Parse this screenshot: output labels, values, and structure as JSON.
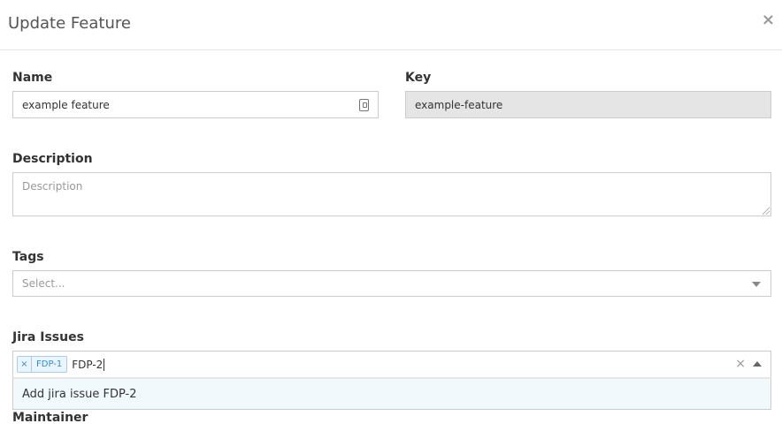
{
  "modal": {
    "title": "Update Feature",
    "close_label": "×"
  },
  "form": {
    "name": {
      "label": "Name",
      "value": "example feature"
    },
    "key": {
      "label": "Key",
      "value": "example-feature"
    },
    "description": {
      "label": "Description",
      "placeholder": "Description"
    },
    "tags": {
      "label": "Tags",
      "placeholder": "Select..."
    },
    "jira": {
      "label": "Jira Issues",
      "selected": [
        {
          "remove_label": "×",
          "label": "FDP-1"
        }
      ],
      "typed": "FDP-2",
      "clear_label": "×",
      "options": [
        {
          "label": "Add jira issue FDP-2"
        }
      ]
    },
    "maintainer": {
      "label": "Maintainer"
    }
  },
  "colors": {
    "chip_bg": "#ebf5ff",
    "chip_text": "#2d8ed8",
    "option_bg": "#f2f9fc",
    "readonly_bg": "#e5e5e5"
  }
}
